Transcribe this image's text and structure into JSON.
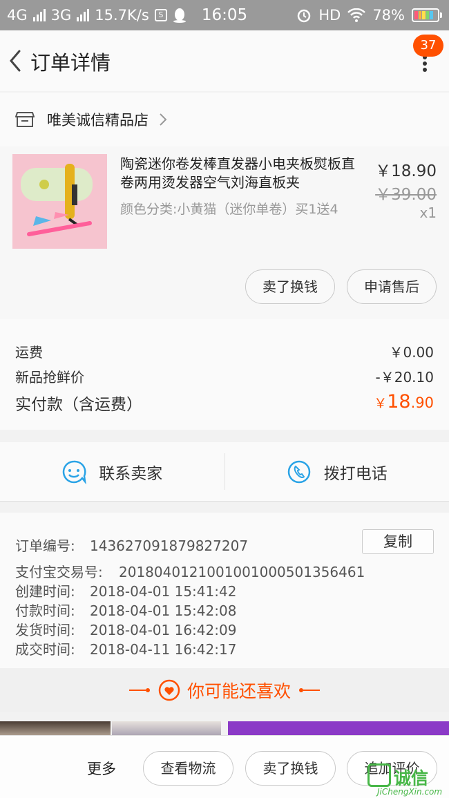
{
  "status_bar": {
    "network1": "4G",
    "network2": "3G",
    "speed": "15.7K/s",
    "s_badge": "S",
    "time": "16:05",
    "hd": "HD",
    "battery_pct": "78%"
  },
  "header": {
    "title": "订单详情",
    "badge_count": "37"
  },
  "shop": {
    "name": "唯美诚信精品店"
  },
  "product": {
    "title": "陶瓷迷你卷发棒直发器小电夹板熨板直卷两用烫发器空气刘海直板夹",
    "props": "颜色分类:小黄猫（迷你单卷）买1送4",
    "price": "￥18.90",
    "original_price": "￥39.00",
    "quantity": "x1",
    "btn_sell": "卖了换钱",
    "btn_aftersale": "申请售后"
  },
  "cost": {
    "shipping_label": "运费",
    "shipping_value": "￥0.00",
    "discount_label": "新品抢鲜价",
    "discount_value": "-￥20.10",
    "total_label": "实付款（含运费）",
    "total_currency": "￥",
    "total_int": "18",
    "total_dec": ".90"
  },
  "contact": {
    "seller_label": "联系卖家",
    "phone_label": "拨打电话"
  },
  "order_info": {
    "order_no_label": "订单编号:",
    "order_no": "143627091879827207",
    "copy_label": "复制",
    "alipay_label": "支付宝交易号:",
    "alipay_no": "2018040121001001000501356461",
    "created_label": "创建时间:",
    "created": "2018-04-01 15:41:42",
    "paid_label": "付款时间:",
    "paid": "2018-04-01 15:42:08",
    "shipped_label": "发货时间:",
    "shipped": "2018-04-01 16:42:09",
    "completed_label": "成交时间:",
    "completed": "2018-04-11 16:42:17"
  },
  "recommend": {
    "title": "你可能还喜欢"
  },
  "bottom_bar": {
    "more": "更多",
    "logistics": "查看物流",
    "sell": "卖了换钱",
    "review": "追加评价"
  },
  "watermark": {
    "text": "诚信",
    "url": "JiChengXin.com"
  },
  "colors": {
    "accent": "#ff5000",
    "icon_blue": "#2aa3e6",
    "status_bar": "#9a9a9a"
  }
}
